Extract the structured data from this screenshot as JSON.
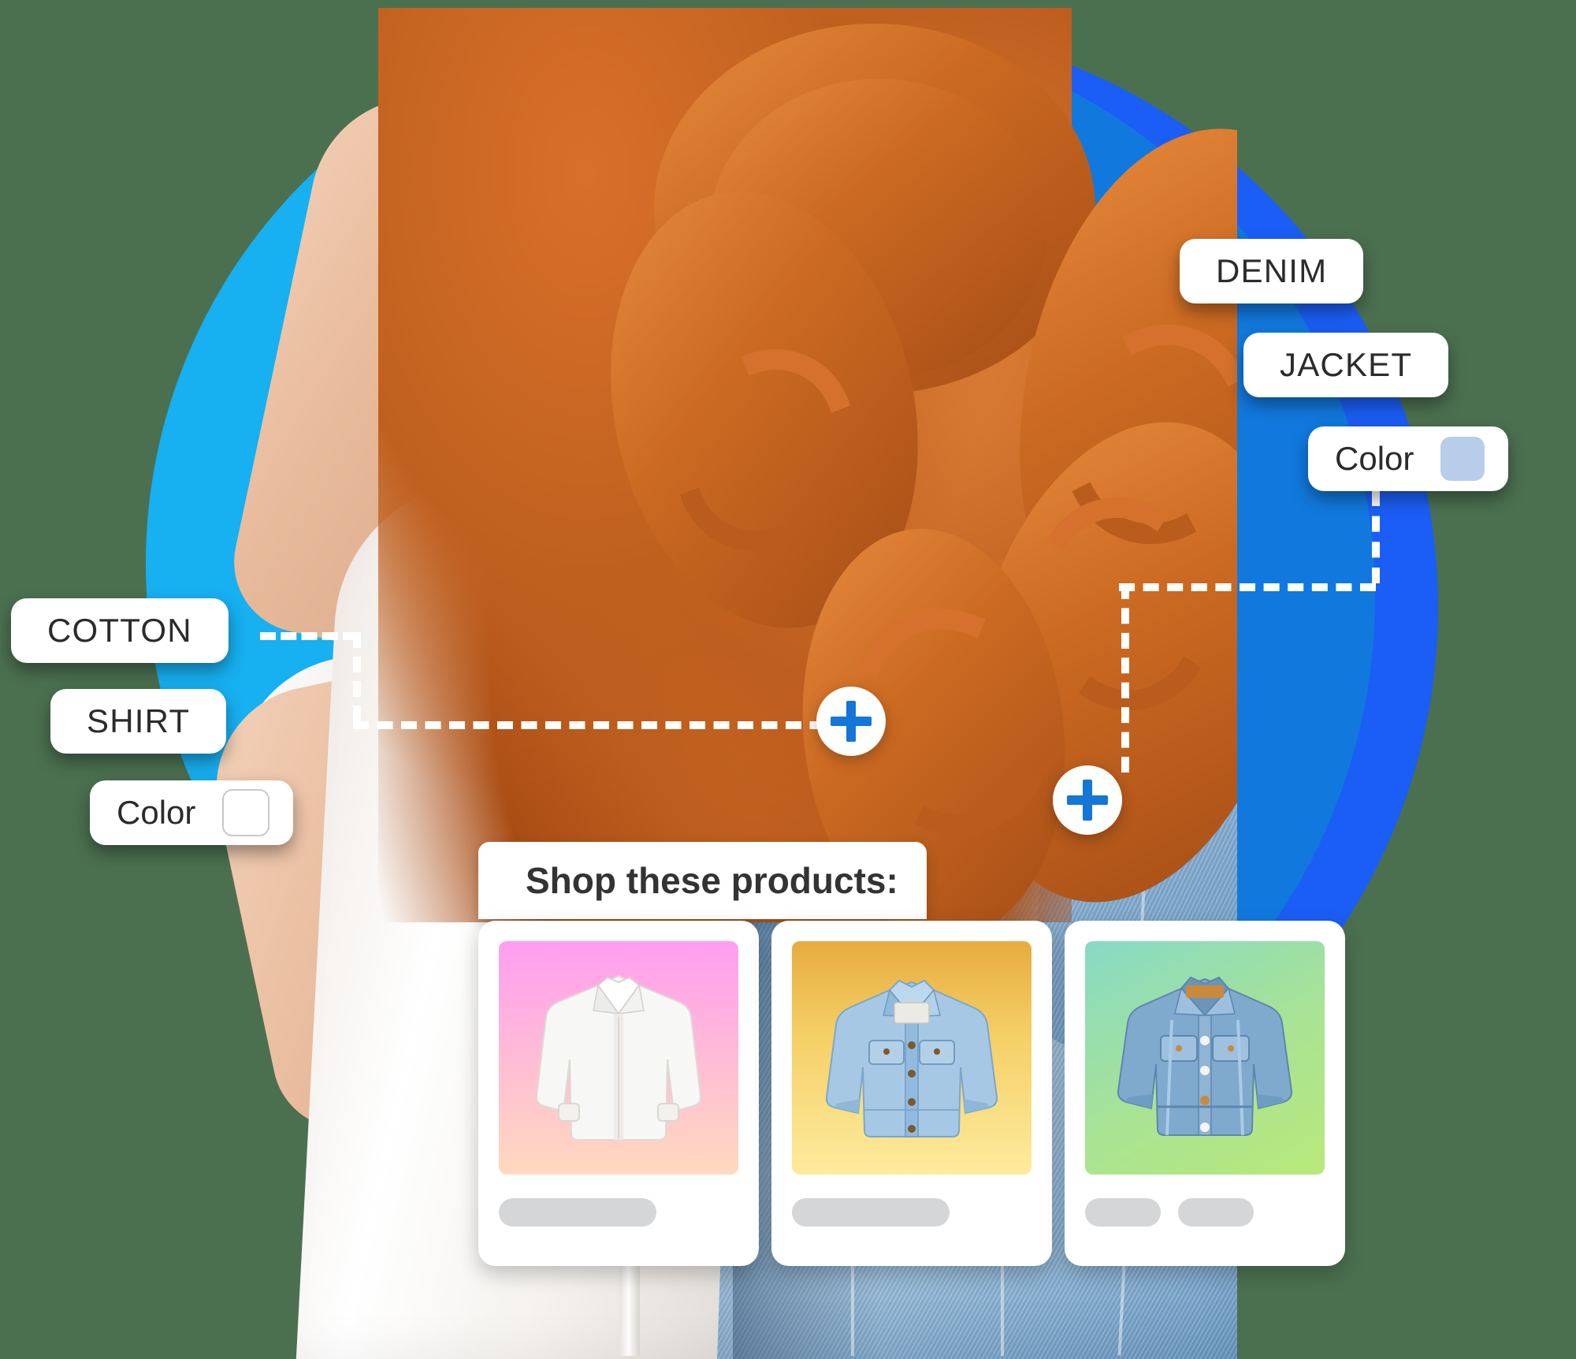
{
  "theme": {
    "page_background": "#4b7050",
    "circle_outer": "#1b5ef5",
    "circle_mid": "#1179de",
    "circle_inner": "#17b0f1",
    "pill_background": "#ffffff",
    "pill_text": "#2b2b2b",
    "plus_icon_color": "#1476d6",
    "dash_color": "#ffffff",
    "placeholder_bar": "#d4d6d8"
  },
  "annotations": {
    "left_group": {
      "material_label": "COTTON",
      "product_label": "SHIRT",
      "color_label": "Color",
      "color_swatch": "#ffffff",
      "color_swatch_style": "empty"
    },
    "right_group": {
      "material_label": "DENIM",
      "product_label": "JACKET",
      "color_label": "Color",
      "color_swatch": "#b7cde9",
      "color_swatch_style": "filled"
    }
  },
  "hotspots": [
    {
      "name": "shirt-hotspot",
      "icon": "plus-icon"
    },
    {
      "name": "jacket-hotspot",
      "icon": "plus-icon"
    }
  ],
  "shop_panel": {
    "title": "Shop these products:",
    "products": [
      {
        "name": "white-cotton-shirt",
        "image": "white-dress-shirt",
        "gradient_from": "#ff9df2",
        "gradient_to": "#ffd9be",
        "bars": [
          "wide"
        ]
      },
      {
        "name": "light-denim-jacket",
        "image": "denim-trucker-jacket",
        "gradient_from": "#efb64a",
        "gradient_to": "#fdeb9d",
        "bars": [
          "wide"
        ]
      },
      {
        "name": "washed-denim-jacket",
        "image": "washed-denim-jacket",
        "gradient_from": "#86dac6",
        "gradient_to": "#b3e87a",
        "bars": [
          "small",
          "small"
        ]
      }
    ]
  },
  "photo": {
    "subject": "smiling-woman-with-curly-red-hair",
    "outfit": "white-shirt-with-denim-jacket"
  }
}
